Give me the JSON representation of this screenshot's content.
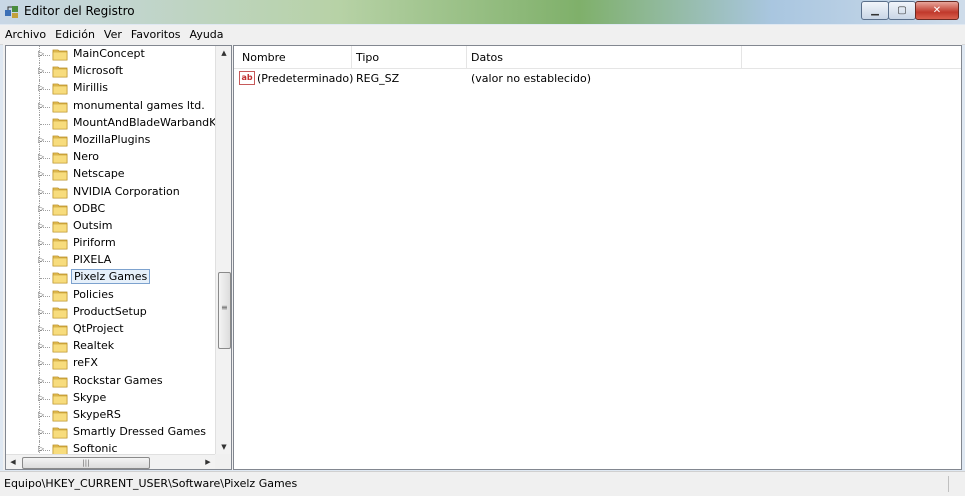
{
  "window": {
    "title": "Editor del Registro"
  },
  "menu": [
    "Archivo",
    "Edición",
    "Ver",
    "Favoritos",
    "Ayuda"
  ],
  "tree": {
    "items": [
      {
        "label": "MainConcept",
        "expandable": true
      },
      {
        "label": "Microsoft",
        "expandable": true
      },
      {
        "label": "Mirillis",
        "expandable": true
      },
      {
        "label": "monumental games ltd.",
        "expandable": true
      },
      {
        "label": "MountAndBladeWarbandKe",
        "expandable": false
      },
      {
        "label": "MozillaPlugins",
        "expandable": true
      },
      {
        "label": "Nero",
        "expandable": true
      },
      {
        "label": "Netscape",
        "expandable": true
      },
      {
        "label": "NVIDIA Corporation",
        "expandable": true
      },
      {
        "label": "ODBC",
        "expandable": true
      },
      {
        "label": "Outsim",
        "expandable": true
      },
      {
        "label": "Piriform",
        "expandable": true
      },
      {
        "label": "PIXELA",
        "expandable": true
      },
      {
        "label": "Pixelz Games",
        "expandable": false,
        "selected": true
      },
      {
        "label": "Policies",
        "expandable": true
      },
      {
        "label": "ProductSetup",
        "expandable": true
      },
      {
        "label": "QtProject",
        "expandable": true
      },
      {
        "label": "Realtek",
        "expandable": true
      },
      {
        "label": "reFX",
        "expandable": true
      },
      {
        "label": "Rockstar Games",
        "expandable": true
      },
      {
        "label": "Skype",
        "expandable": true
      },
      {
        "label": "SkypeRS",
        "expandable": true
      },
      {
        "label": "Smartly Dressed Games",
        "expandable": true
      },
      {
        "label": "Softonic",
        "expandable": true
      }
    ]
  },
  "list": {
    "columns": [
      "Nombre",
      "Tipo",
      "Datos"
    ],
    "rows": [
      {
        "name": "(Predeterminado)",
        "type": "REG_SZ",
        "data": "(valor no establecido)",
        "icon": "string-value-icon"
      }
    ]
  },
  "status": {
    "path": "Equipo\\HKEY_CURRENT_USER\\Software\\Pixelz Games"
  }
}
